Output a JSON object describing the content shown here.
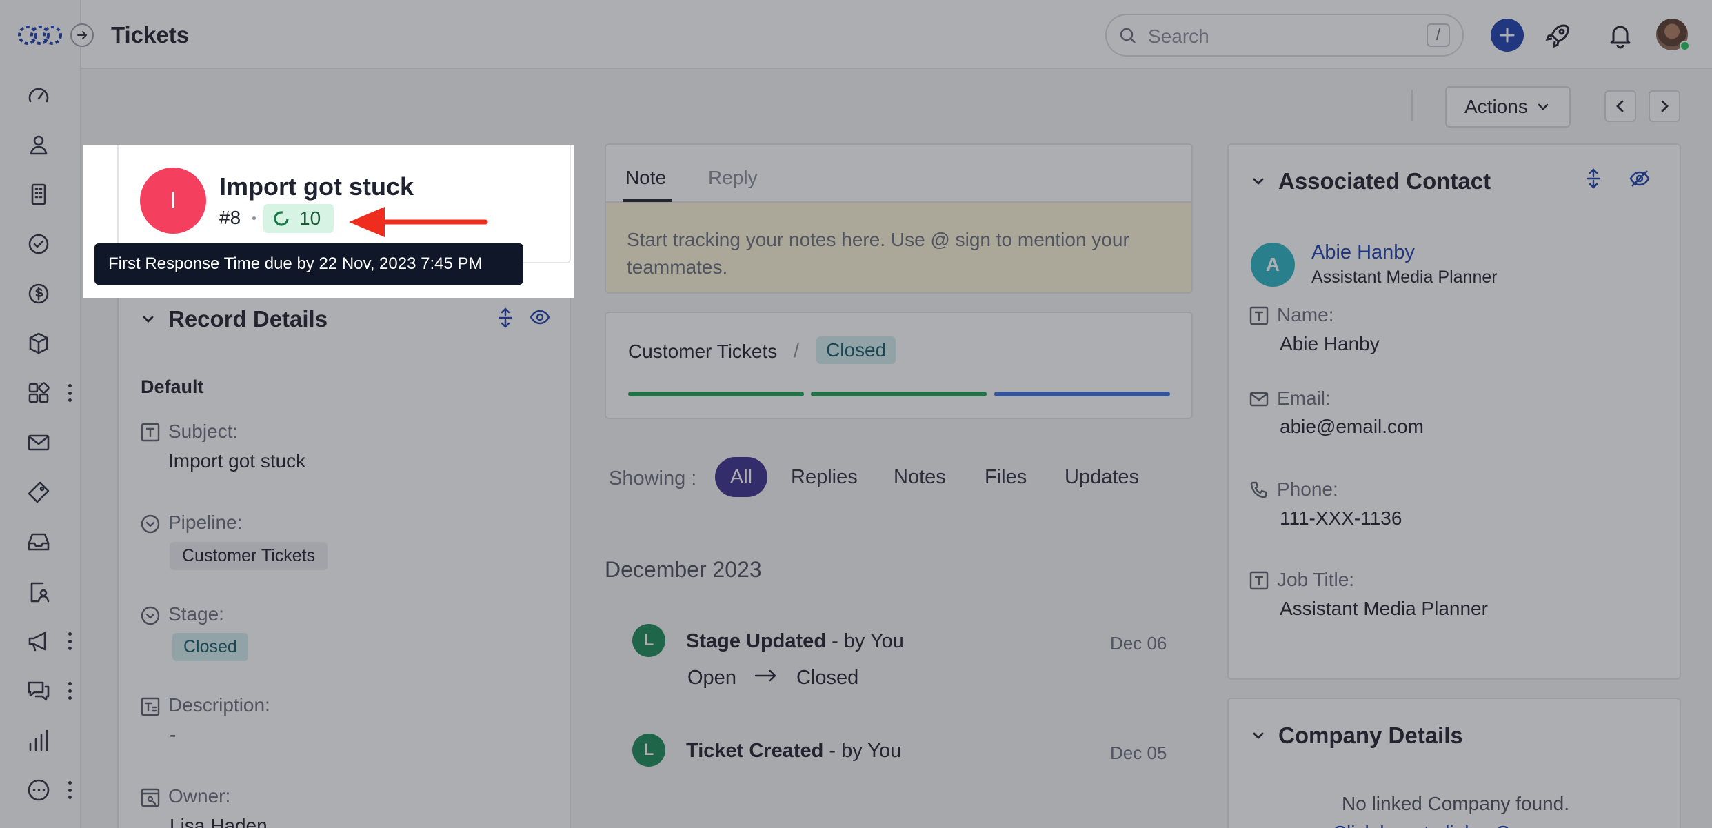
{
  "topbar": {
    "title": "Tickets",
    "search_placeholder": "Search",
    "search_shortcut": "/"
  },
  "toolbar": {
    "actions_label": "Actions"
  },
  "header_card": {
    "avatar_letter": "I",
    "title": "Import got stuck",
    "ticket_number": "#8",
    "sla_value": "10",
    "tooltip": "First Response Time due by 22 Nov, 2023 7:45 PM"
  },
  "record_details": {
    "title": "Record Details",
    "section": "Default",
    "fields": [
      {
        "label": "Subject:",
        "value": "Import got stuck"
      },
      {
        "label": "Pipeline:",
        "value": "Customer Tickets"
      },
      {
        "label": "Stage:",
        "value": "Closed"
      },
      {
        "label": "Description:",
        "value": "-"
      },
      {
        "label": "Owner:",
        "value": "Lisa Haden"
      }
    ]
  },
  "composer": {
    "tabs": [
      "Note",
      "Reply"
    ],
    "placeholder": "Start tracking your notes here. Use @ sign to mention your teammates."
  },
  "pipeline_card": {
    "pipeline": "Customer Tickets",
    "separator": "/",
    "stage": "Closed",
    "progress_colors": [
      "#1f9d55",
      "#1f9d55",
      "#3a6fd8"
    ]
  },
  "activity": {
    "showing_label": "Showing :",
    "filters": [
      "All",
      "Replies",
      "Notes",
      "Files",
      "Updates"
    ],
    "month": "December 2023",
    "items": [
      {
        "avatar": "L",
        "title": "Stage Updated",
        "by": " - by You",
        "date": "Dec 06",
        "from": "Open",
        "to": "Closed"
      },
      {
        "avatar": "L",
        "title": "Ticket Created",
        "by": " - by You",
        "date": "Dec 05"
      }
    ]
  },
  "associated_contact": {
    "title": "Associated Contact",
    "avatar_letter": "A",
    "name": "Abie Hanby",
    "role": "Assistant Media Planner",
    "fields": [
      {
        "label": "Name:",
        "value": "Abie Hanby"
      },
      {
        "label": "Email:",
        "value": "abie@email.com"
      },
      {
        "label": "Phone:",
        "value": "111-XXX-1136"
      },
      {
        "label": "Job Title:",
        "value": "Assistant Media Planner"
      }
    ]
  },
  "company_details": {
    "title": "Company Details",
    "empty_text": "No linked Company found.",
    "cta_text": "Click here to link a Company"
  },
  "colors": {
    "accent": "#1e40af",
    "avatar_red": "#f43f5e",
    "contact_teal": "#2ab3c4",
    "highlight_arrow": "#ef2d1e",
    "tooltip_bg": "#0f1729"
  }
}
